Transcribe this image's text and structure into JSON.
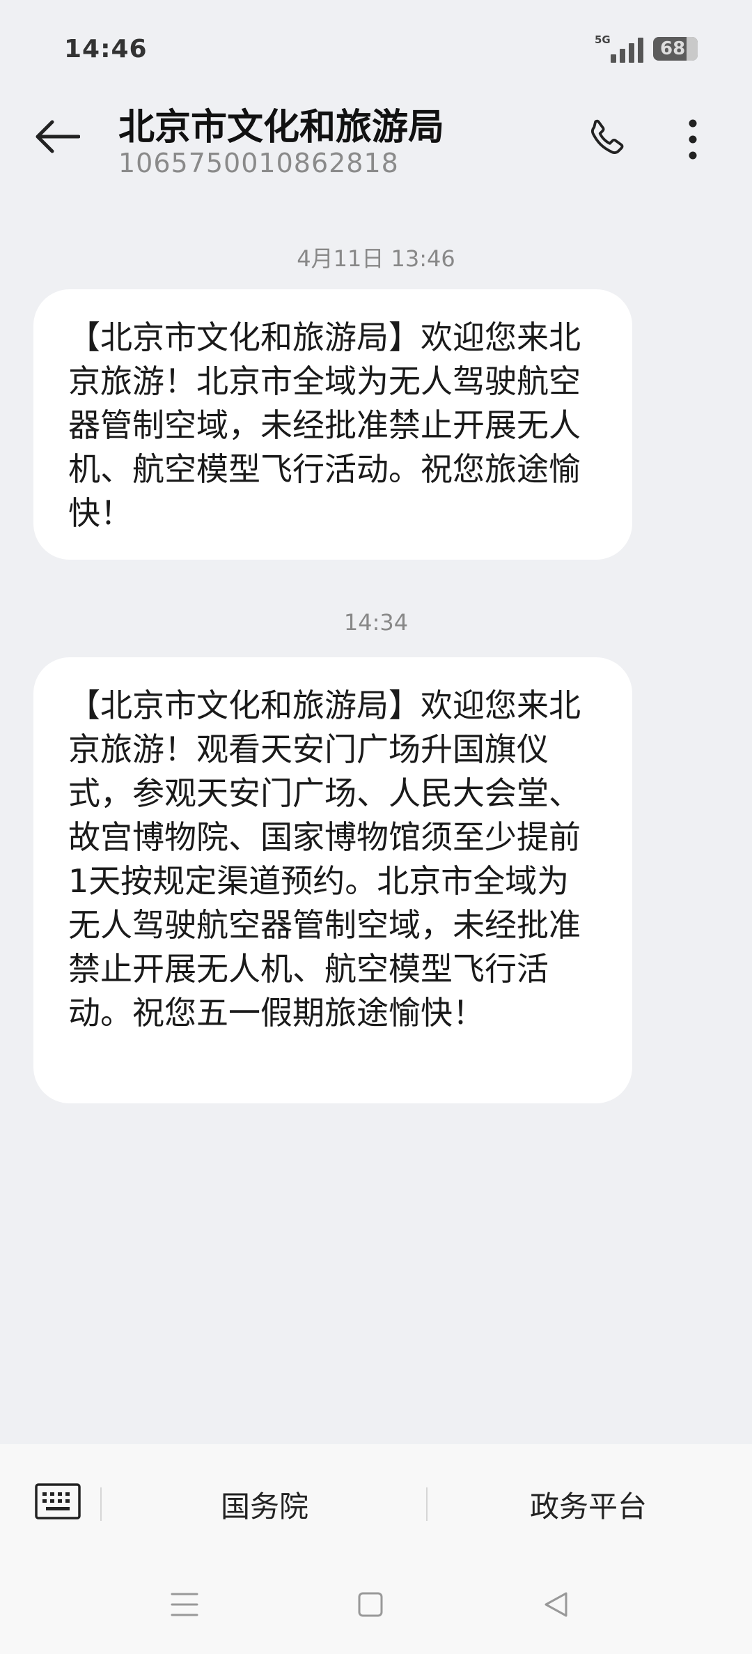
{
  "status_bar": {
    "time": "14:46",
    "network": "5G",
    "battery": "68"
  },
  "header": {
    "title": "北京市文化和旅游局",
    "number": "1065750010862818",
    "icons": [
      "back-arrow-icon",
      "phone-icon",
      "more-vertical-icon"
    ]
  },
  "messages": [
    {
      "timestamp": "4月11日 13:46",
      "text": "【北京市文化和旅游局】欢迎您来北京旅游！北京市全域为无人驾驶航空器管制空域，未经批准禁止开展无人机、航空模型飞行活动。祝您旅途愉快！"
    },
    {
      "timestamp": "14:34",
      "text": "【北京市文化和旅游局】欢迎您来北京旅游！观看天安门广场升国旗仪式，参观天安门广场、人民大会堂、故宫博物院、国家博物馆须至少提前1天按规定渠道预约。北京市全域为无人驾驶航空器管制空域，未经批准禁止开展无人机、航空模型飞行活动。祝您五一假期旅途愉快！"
    }
  ],
  "bottom_menu": {
    "items": [
      "国务院",
      "政务平台"
    ],
    "keyboard_icon": "keyboard-icon"
  },
  "nav_bar": {
    "icons": [
      "menu-icon",
      "home-square-icon",
      "back-triangle-icon"
    ]
  },
  "colors": {
    "background": "#eff0f3",
    "bubble": "#ffffff",
    "muted_text": "#8a8a8a"
  }
}
